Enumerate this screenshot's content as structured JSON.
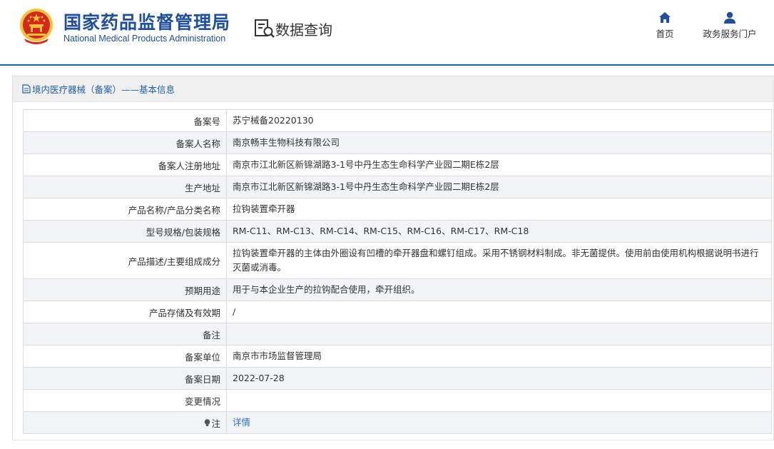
{
  "header": {
    "org_name_cn": "国家药品监督管理局",
    "org_name_en": "National Medical Products Administration",
    "query_title": "数据查询",
    "nav": [
      {
        "label": "首页",
        "icon": "home-icon"
      },
      {
        "label": "政务服务门户",
        "icon": "user-icon"
      }
    ]
  },
  "colors": {
    "brand_blue": "#1f4fa0",
    "link_blue": "#2a6fc2",
    "emblem_red": "#d7261e",
    "emblem_gold": "#f2c23a"
  },
  "panel": {
    "title": "境内医疗器械（备案）——基本信息",
    "icon": "document-icon"
  },
  "rows": [
    {
      "label": "备案号",
      "value": "苏宁械备20220130"
    },
    {
      "label": "备案人名称",
      "value": "南京畅丰生物科技有限公司"
    },
    {
      "label": "备案人注册地址",
      "value": "南京市江北新区新锦湖路3-1号中丹生态生命科学产业园二期E栋2层"
    },
    {
      "label": "生产地址",
      "value": "南京市江北新区新锦湖路3-1号中丹生态生命科学产业园二期E栋2层"
    },
    {
      "label": "产品名称/产品分类名称",
      "value": "拉钩装置牵开器"
    },
    {
      "label": "型号规格/包装规格",
      "value": "RM-C11、RM-C13、RM-C14、RM-C15、RM-C16、RM-C17、RM-C18"
    },
    {
      "label": "产品描述/主要组成成分",
      "value": "拉钩装置牵开器的主体由外圈设有凹槽的牵开器盘和螺钉组成。采用不锈钢材料制成。非无菌提供。使用前由使用机构根据说明书进行灭菌或消毒。"
    },
    {
      "label": "预期用途",
      "value": "用于与本企业生产的拉钩配合使用，牵开组织。"
    },
    {
      "label": "产品存储及有效期",
      "value": "/"
    },
    {
      "label": "备注",
      "value": ""
    },
    {
      "label": "备案单位",
      "value": "南京市市场监督管理局"
    },
    {
      "label": "备案日期",
      "value": "2022-07-28"
    },
    {
      "label": "变更情况",
      "value": ""
    },
    {
      "label": "注",
      "value": "详情",
      "icon": "bulb-icon"
    }
  ]
}
